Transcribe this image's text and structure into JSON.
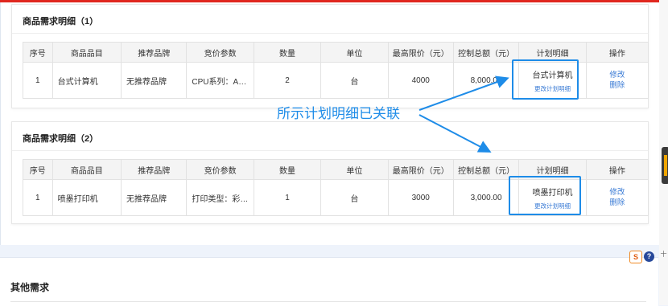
{
  "table_headers": [
    "序号",
    "商品品目",
    "推荐品牌",
    "竞价参数",
    "数量",
    "单位",
    "最高限价（元）",
    "控制总额（元）",
    "计划明细",
    "操作"
  ],
  "cards": [
    {
      "title": "商品需求明细（1）",
      "row": {
        "index": "1",
        "category": "台式计算机",
        "brand": "无推荐品牌",
        "params": "CPU系列：AM...",
        "quantity": "2",
        "unit": "台",
        "max_price": "4000",
        "total": "8,000.00",
        "plan_name": "台式计算机",
        "plan_link": "更改计划明细",
        "op_edit": "修改",
        "op_delete": "删除"
      }
    },
    {
      "title": "商品需求明细（2）",
      "row": {
        "index": "1",
        "category": "喷墨打印机",
        "brand": "无推荐品牌",
        "params": "打印类型：彩色...",
        "quantity": "1",
        "unit": "台",
        "max_price": "3000",
        "total": "3,000.00",
        "plan_name": "喷墨打印机",
        "plan_link": "更改计划明细",
        "op_edit": "修改",
        "op_delete": "删除"
      }
    }
  ],
  "annotation": "所示计划明细已关联",
  "lower": {
    "title": "其他需求"
  },
  "toolbar": {
    "ime_label": "S",
    "help_label": "?",
    "side_glyph": "十"
  },
  "colors": {
    "accent": "#1e8ce8",
    "link": "#3a7bd5",
    "top_bar": "#e0271f"
  }
}
